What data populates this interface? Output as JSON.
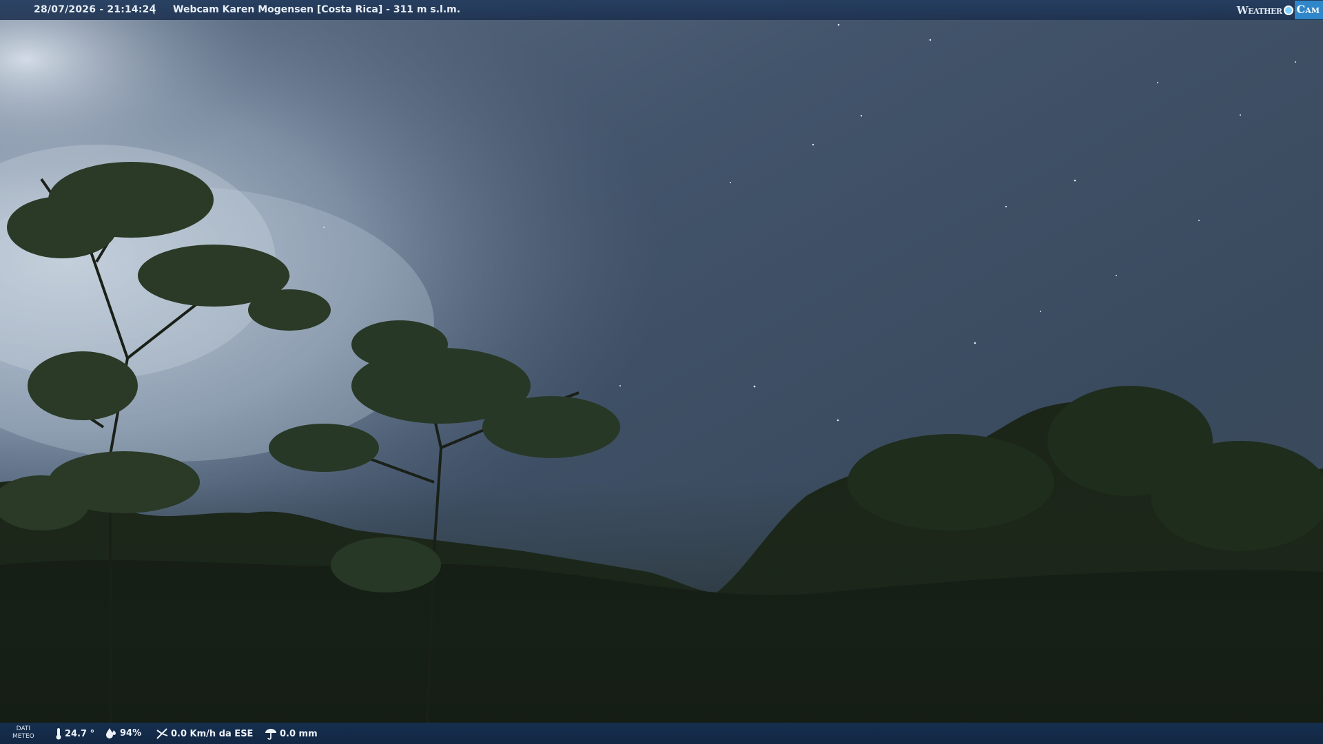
{
  "header": {
    "timestamp": "28/07/2026 - 21:14:24",
    "separator": "|",
    "title": "Webcam Karen Mogensen [Costa Rica] - 311 m s.l.m."
  },
  "logo": {
    "part1": "Weather",
    "part2": "Cam"
  },
  "footer": {
    "label_line1": "DATI",
    "label_line2": "METEO",
    "temperature": "24.7 °",
    "humidity": "94%",
    "wind": "0.0 Km/h da ESE",
    "rain": "0.0 mm"
  },
  "colors": {
    "bar": "#1f3a60",
    "logo_accent": "#2f86c8",
    "sky_top": "#3b4a5e",
    "sky_cloud": "#b9c6d6",
    "foliage": "#1a2419"
  },
  "icons": [
    "thermometer-icon",
    "humidity-icon",
    "wind-icon",
    "rain-icon"
  ]
}
